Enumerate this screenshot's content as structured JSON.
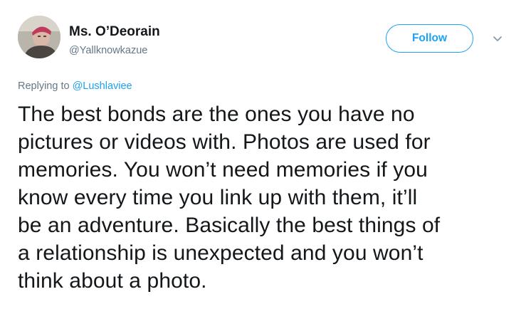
{
  "author": {
    "display_name": "Ms. O’Deorain",
    "handle": "@Yallknowkazue",
    "avatar": "profile-photo"
  },
  "actions": {
    "follow_label": "Follow",
    "more_icon": "chevron-down-icon"
  },
  "reply": {
    "prefix": "Replying to",
    "mention": "@Lushlaviee"
  },
  "tweet": {
    "lines": [
      "The best bonds are the ones you have no",
      "pictures or videos with. Photos are used for",
      "memories. You won’t need memories if you",
      "know every time you link up with them, it’ll",
      "be an adventure. Basically the best things of",
      "a relationship is unexpected and you won’t",
      "think about a photo."
    ]
  },
  "colors": {
    "accent": "#1da1f2",
    "text": "#14171a",
    "secondary": "#657786"
  }
}
